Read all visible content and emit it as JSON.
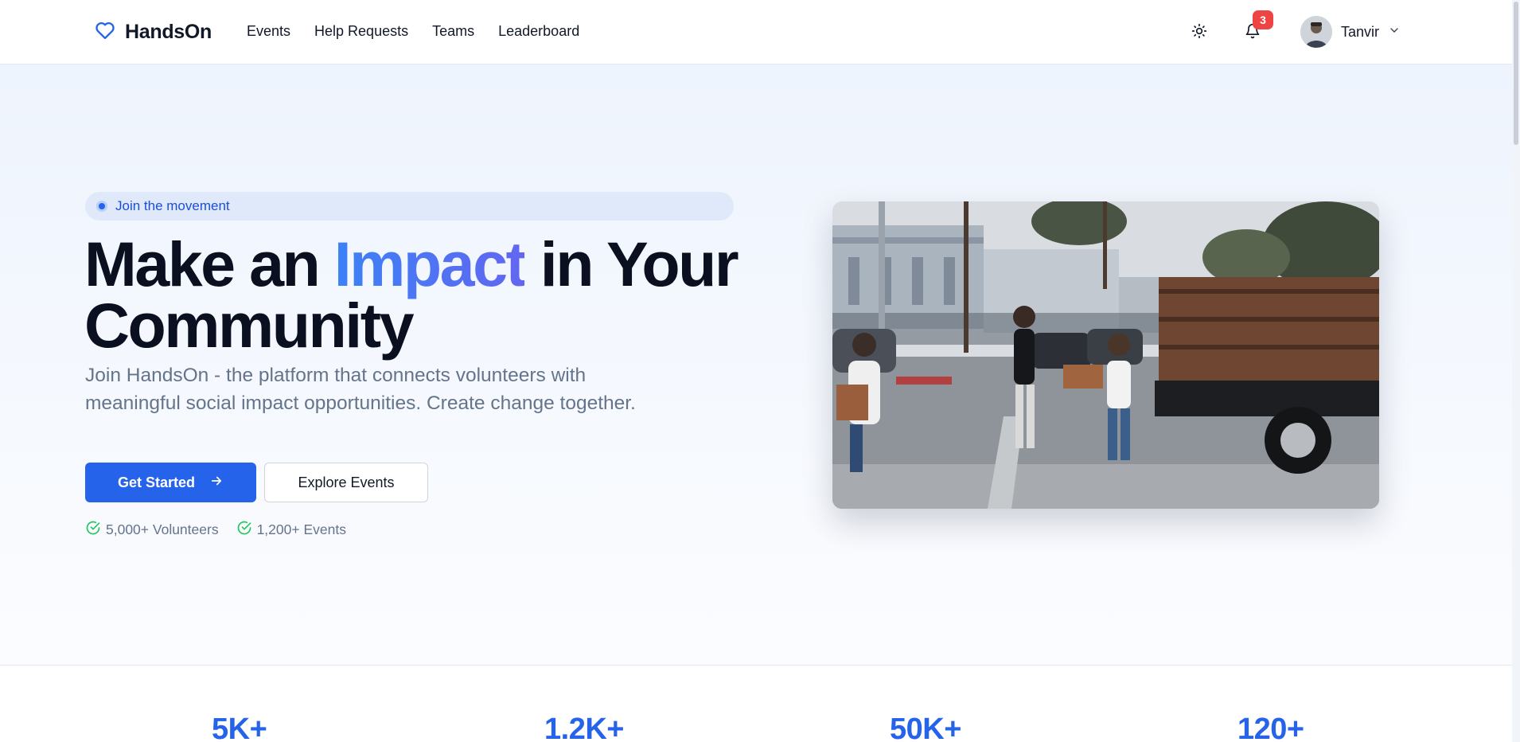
{
  "brand": {
    "name": "HandsOn",
    "icon": "heart-icon",
    "color": "#2563eb"
  },
  "nav": {
    "items": [
      {
        "label": "Events"
      },
      {
        "label": "Help Requests"
      },
      {
        "label": "Teams"
      },
      {
        "label": "Leaderboard"
      }
    ]
  },
  "header": {
    "theme_icon": "sun-icon",
    "bell_icon": "bell-icon",
    "notification_count": "3",
    "user_name": "Tanvir"
  },
  "hero": {
    "pill_text": "Join the movement",
    "headline_before": "Make an ",
    "headline_accent": "Impact",
    "headline_after": " in Your Community",
    "subtext": "Join HandsOn - the platform that connects volunteers with meaningful social impact opportunities. Create change together.",
    "primary_button": "Get Started",
    "secondary_button": "Explore Events",
    "checks": [
      {
        "label": "5,000+ Volunteers"
      },
      {
        "label": "1,200+ Events"
      }
    ]
  },
  "stats": {
    "items": [
      {
        "value": "5K+"
      },
      {
        "value": "1.2K+"
      },
      {
        "value": "50K+"
      },
      {
        "value": "120+"
      }
    ]
  },
  "colors": {
    "accent": "#2563eb",
    "badge": "#ef4444",
    "check": "#22c55e"
  }
}
